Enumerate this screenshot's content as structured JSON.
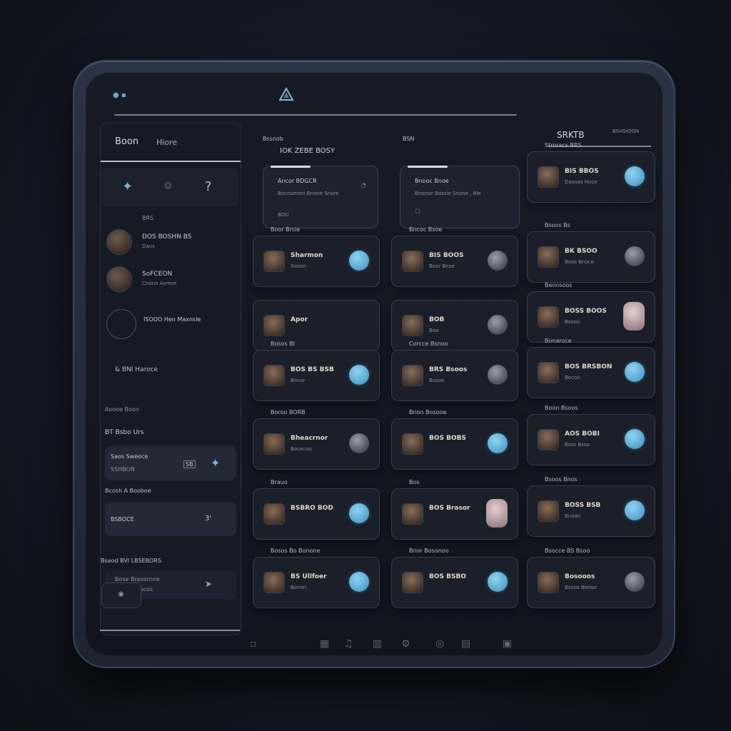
{
  "topbar": {
    "dots_icon": "status-dots-icon",
    "logo_icon": "app-logo-icon"
  },
  "sidebar": {
    "title": "Boon",
    "subtitle": "Hiore",
    "section_a": "BRS",
    "items": [
      {
        "title": "DOS BOSHN BS",
        "sub": "Daus"
      },
      {
        "title": "SoFCEON",
        "sub": "Cnono Aorese"
      },
      {
        "title": "ISOOO Hen Maxnsle",
        "sub": ""
      }
    ],
    "section_b": "& BNI Haroce",
    "section_c": "Aoooe Boon",
    "row_c": "BT   Bsbo Urs",
    "card_c": {
      "t1": "Saos Sweoce",
      "t2": "SSHBON",
      "tag": "SB"
    },
    "section_d": "Bcosh A Booboe",
    "card_d": {
      "t1": "BSBOCE",
      "tag": "3'"
    },
    "section_e": "Bsaod BVI LBSEBORS",
    "card_e": {
      "t1": "Bose Breosrnoe",
      "t2": "Baor Borocos"
    }
  },
  "columns": {
    "col1_label": "Bssnob",
    "col1_header": "IOK ZEBE BOSY",
    "col2_label": "BSN",
    "tab1": {
      "t1": "Ancor BDGCR",
      "t2": "Bocoumsni Bnone Snore",
      "t3": "BOU"
    },
    "tab2": {
      "t1": "Bnooc Bnoe",
      "t2": "Bnonse Bossie Snone , BIe",
      "t3": ""
    }
  },
  "right_header": {
    "title": "SRKTB",
    "small": "BSHSIOON"
  },
  "cards_col1": [
    {
      "section": "Boor Brsie",
      "title": "Sharmon",
      "sub": "Sooon",
      "end": "blue"
    },
    {
      "section": "",
      "title": "Apor",
      "sub": "",
      "end": "none"
    },
    {
      "section": "Bosos BI",
      "title": "BOS BS BSB",
      "sub": "Bonar",
      "end": "blue"
    },
    {
      "section": "Boroo   BORB",
      "title": "Bheacrnor",
      "sub": "Bocecoo",
      "end": "dark"
    },
    {
      "section": "Brauo",
      "title": "BSBRO BOD",
      "sub": "",
      "end": "blue"
    },
    {
      "section": "Bosos Bo Bonone",
      "title": "BS Ullfoer",
      "sub": "Bonon",
      "end": "blue"
    }
  ],
  "cards_col2": [
    {
      "section": "Bncoc Bsoe",
      "title": "BIS BOOS",
      "sub": "Boor Bnse",
      "end": "dark"
    },
    {
      "section": "",
      "title": "BOB",
      "sub": "Boe",
      "end": "dark"
    },
    {
      "section": "Corcce Bsnoo",
      "title": "BRS Bsoos",
      "sub": "Bosoo",
      "end": "dark"
    },
    {
      "section": "Bnon Bosooe",
      "title": "BOS BOBS",
      "sub": "",
      "end": "blue"
    },
    {
      "section": "Bos",
      "title": "BOS Brasor",
      "sub": "",
      "end": "skin"
    },
    {
      "section": "Bnor Bosonoo",
      "title": "BOS BSBO",
      "sub": "",
      "end": "blue"
    }
  ],
  "cards_col3": [
    {
      "section": "Stroracs BRS",
      "title": "BIS BBOS",
      "sub": "Daosas Hoce",
      "end": "blue"
    },
    {
      "section": "Bsoos Bs",
      "title": "BK BSOO",
      "sub": "Boos Bnoce",
      "end": "dark"
    },
    {
      "section": "Beonsoos",
      "title": "BOSS BOOS",
      "sub": "Bsooo",
      "end": "skin"
    },
    {
      "section": "Bonaroce",
      "title": "BOS BRSBON",
      "sub": "Bocon",
      "end": "blue"
    },
    {
      "section": "Boon Bsoos",
      "title": "AOS BOBI",
      "sub": "Boor Bsso",
      "end": "blue"
    },
    {
      "section": "Bsoos Bnos",
      "title": "BOSS BSB",
      "sub": "Bnoon",
      "end": "blue"
    },
    {
      "section": "Bsocce BS Bsoo",
      "title": "Bosooos",
      "sub": "Bsoos Bonoe",
      "end": "dark"
    }
  ],
  "dock_icons": [
    "home-icon",
    "grid-icon",
    "music-icon",
    "column-icon",
    "gear-icon",
    "globe-icon",
    "chart-icon",
    "window-icon"
  ],
  "colors": {
    "accent": "#5aaee0",
    "panel": "#1a1f2a",
    "bg": "#12151d"
  }
}
